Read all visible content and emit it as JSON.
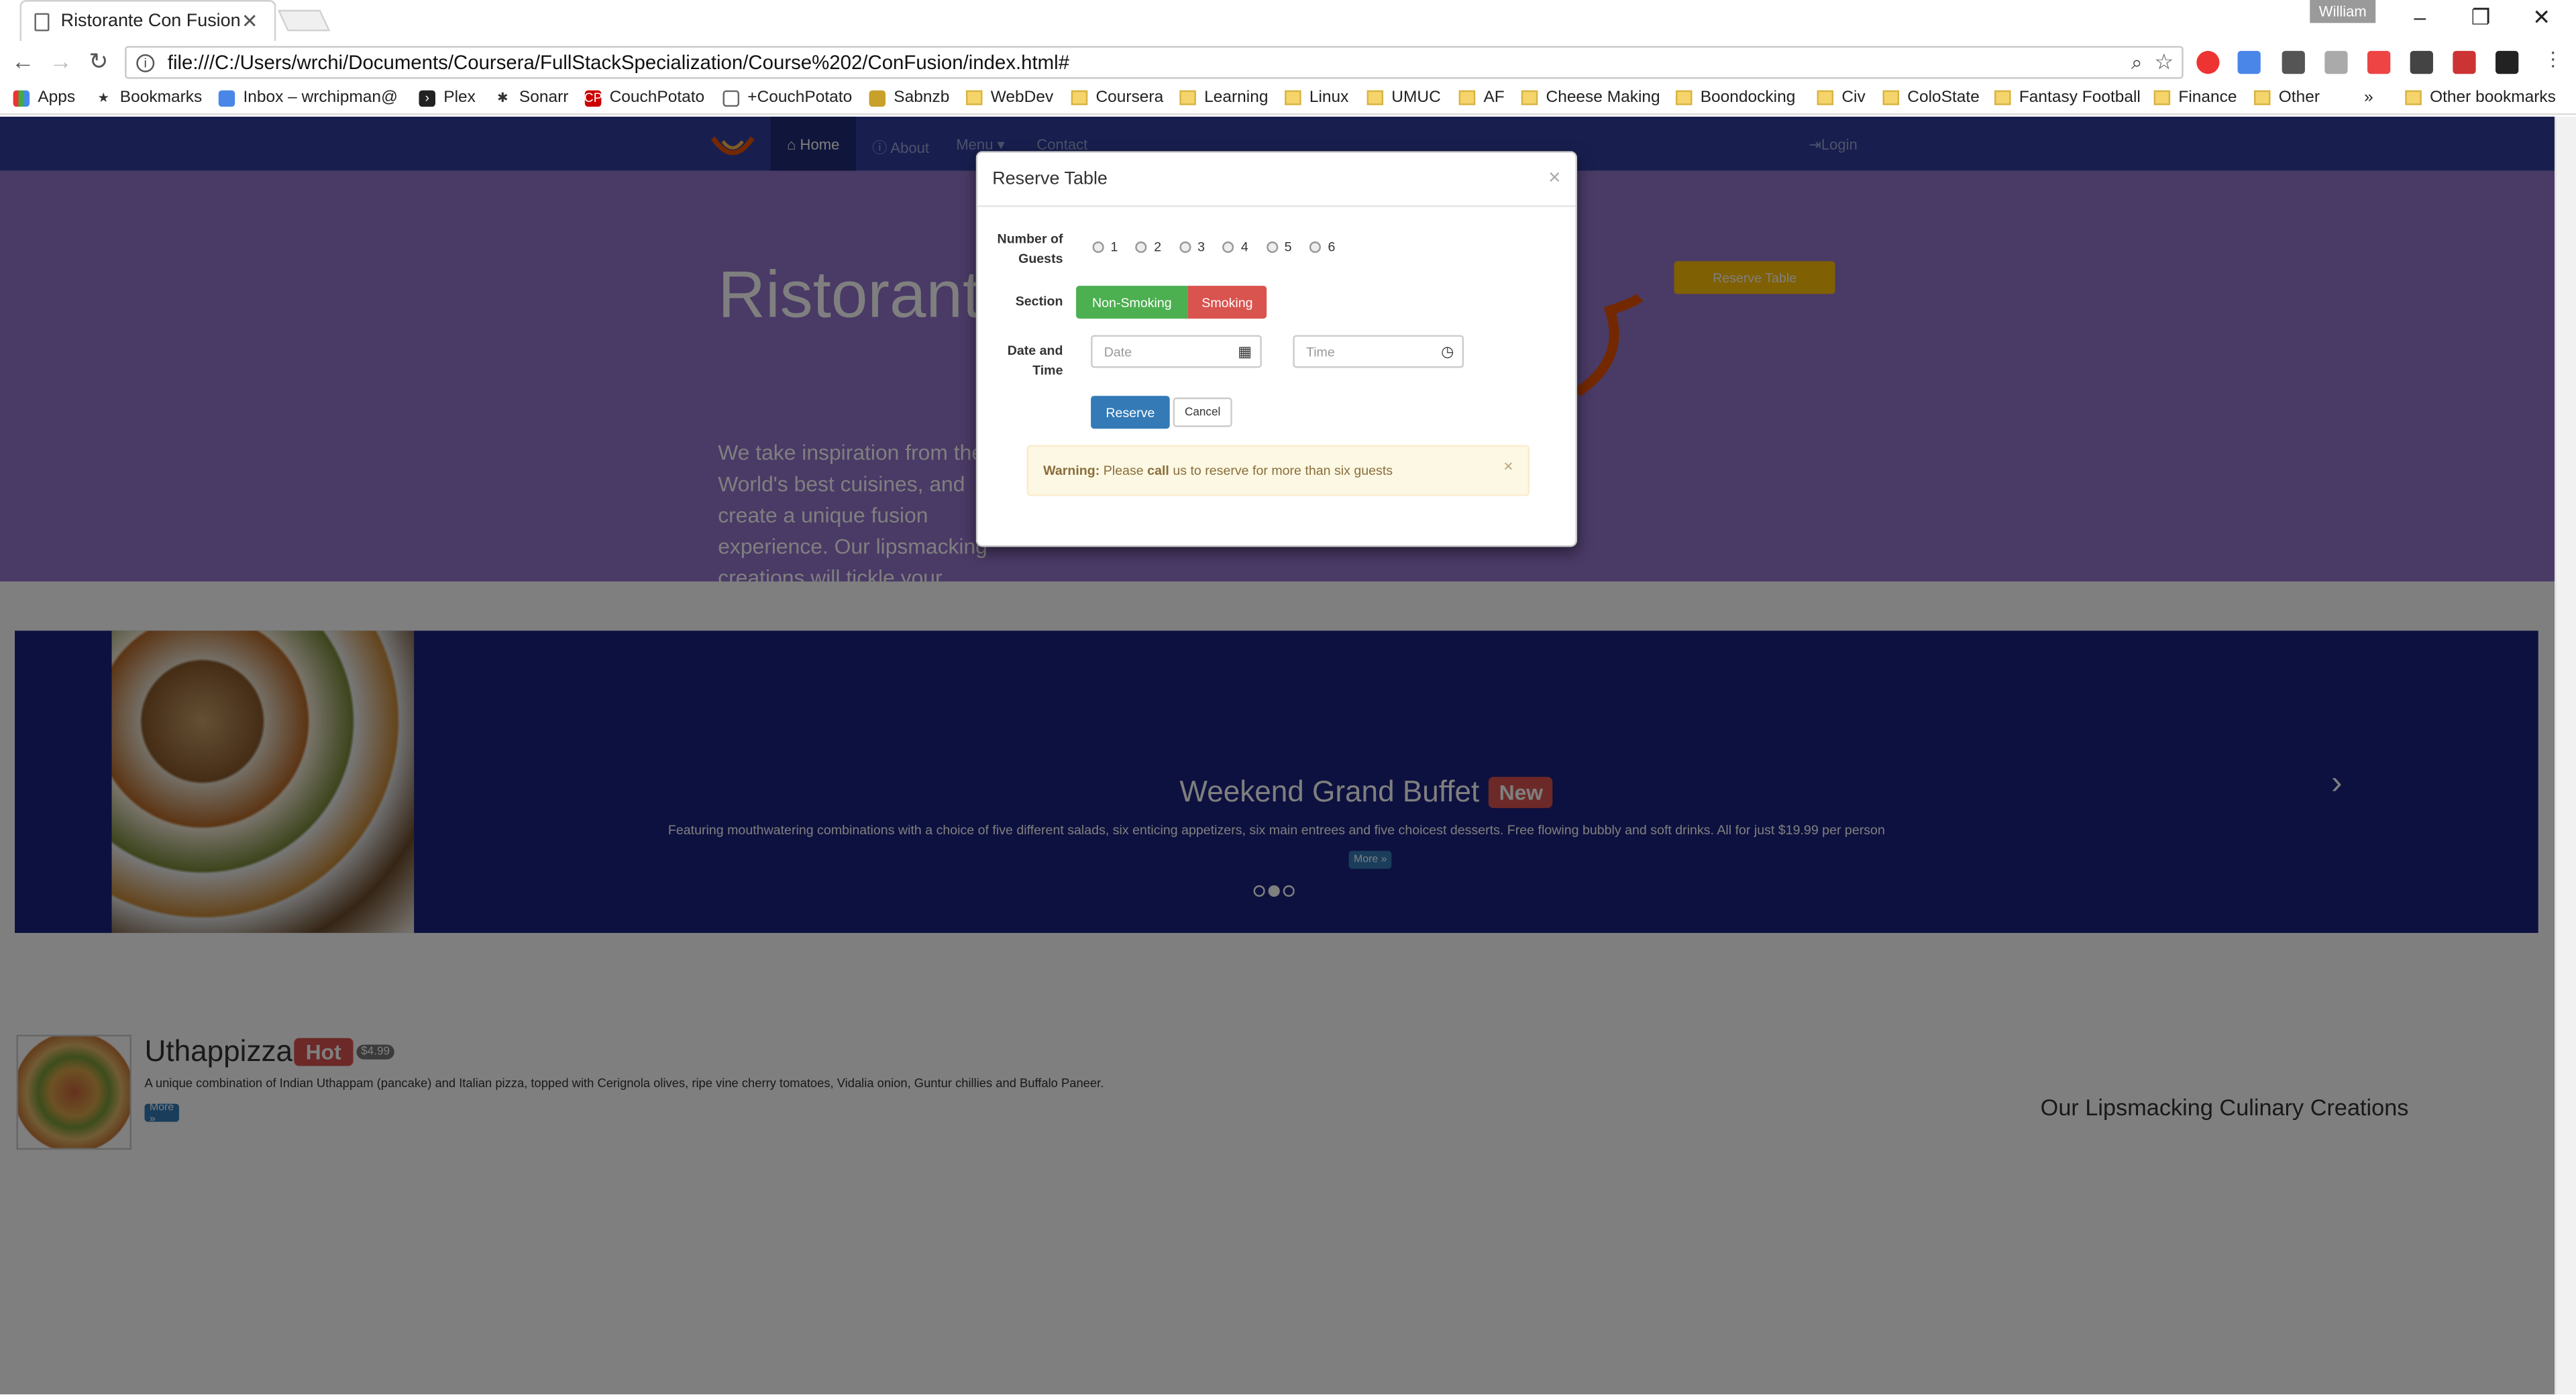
{
  "browser": {
    "tab_title": "Ristorante Con Fusion",
    "user": "William",
    "url": "file:///C:/Users/wrchi/Documents/Coursera/FullStackSpecialization/Course%202/ConFusion/index.html#"
  },
  "bookmarks": [
    "Apps",
    "Bookmarks",
    "Inbox – wrchipman@",
    "Plex",
    "Sonarr",
    "CouchPotato",
    "+CouchPotato",
    "Sabnzb",
    "WebDev",
    "Coursera",
    "Learning",
    "Linux",
    "UMUC",
    "AF",
    "Cheese Making",
    "Boondocking",
    "Civ",
    "ColoState",
    "Fantasy Football",
    "Finance",
    "Other",
    "»",
    "Other bookmarks"
  ],
  "navbar": {
    "home": "Home",
    "about": "About",
    "menu": "Menu ▾",
    "contact": "Contact",
    "login": "Login"
  },
  "jumbotron": {
    "title": "Ristorante con Fusion",
    "description": "We take inspiration from the World's best cuisines, and create a unique fusion experience. Our lipsmacking creations will tickle your culinary senses!",
    "reserve_button": "Reserve Table"
  },
  "carousel": {
    "title": "Weekend Grand Buffet",
    "badge": "New",
    "description": "Featuring mouthwatering combinations with a choice of five different salads, six enticing appetizers, six main entrees and five choicest desserts. Free flowing bubbly and soft drinks. All for just $19.99 per person",
    "more": "More »",
    "active_slide": 2,
    "slide_count": 3
  },
  "featured": {
    "title": "Uthappizza",
    "badge": "Hot",
    "price": "$4.99",
    "description": "A unique combination of Indian Uthappam (pancake) and Italian pizza, topped with Cerignola olives, ripe vine cherry tomatoes, Vidalia onion, Guntur chillies and Buffalo Paneer.",
    "more": "More »",
    "side_heading": "Our Lipsmacking Culinary Creations"
  },
  "modal": {
    "title": "Reserve Table",
    "guests_label": "Number of Guests",
    "guest_options": [
      "1",
      "2",
      "3",
      "4",
      "5",
      "6"
    ],
    "section_label": "Section",
    "non_smoking": "Non-Smoking",
    "smoking": "Smoking",
    "datetime_label": "Date and Time",
    "date_placeholder": "Date",
    "time_placeholder": "Time",
    "reserve_button": "Reserve",
    "cancel_button": "Cancel",
    "warning_strong": "Warning:",
    "warning_pre": "Please",
    "warning_call": "call",
    "warning_post": "us to reserve for more than six guests"
  },
  "colors": {
    "navbar": "#303f9f",
    "jumbotron": "#9575cd",
    "carousel": "#1a237e",
    "primary": "#337ab7",
    "success": "#4caf50",
    "danger": "#d9534f",
    "warning_bg": "#fcf8e3"
  }
}
